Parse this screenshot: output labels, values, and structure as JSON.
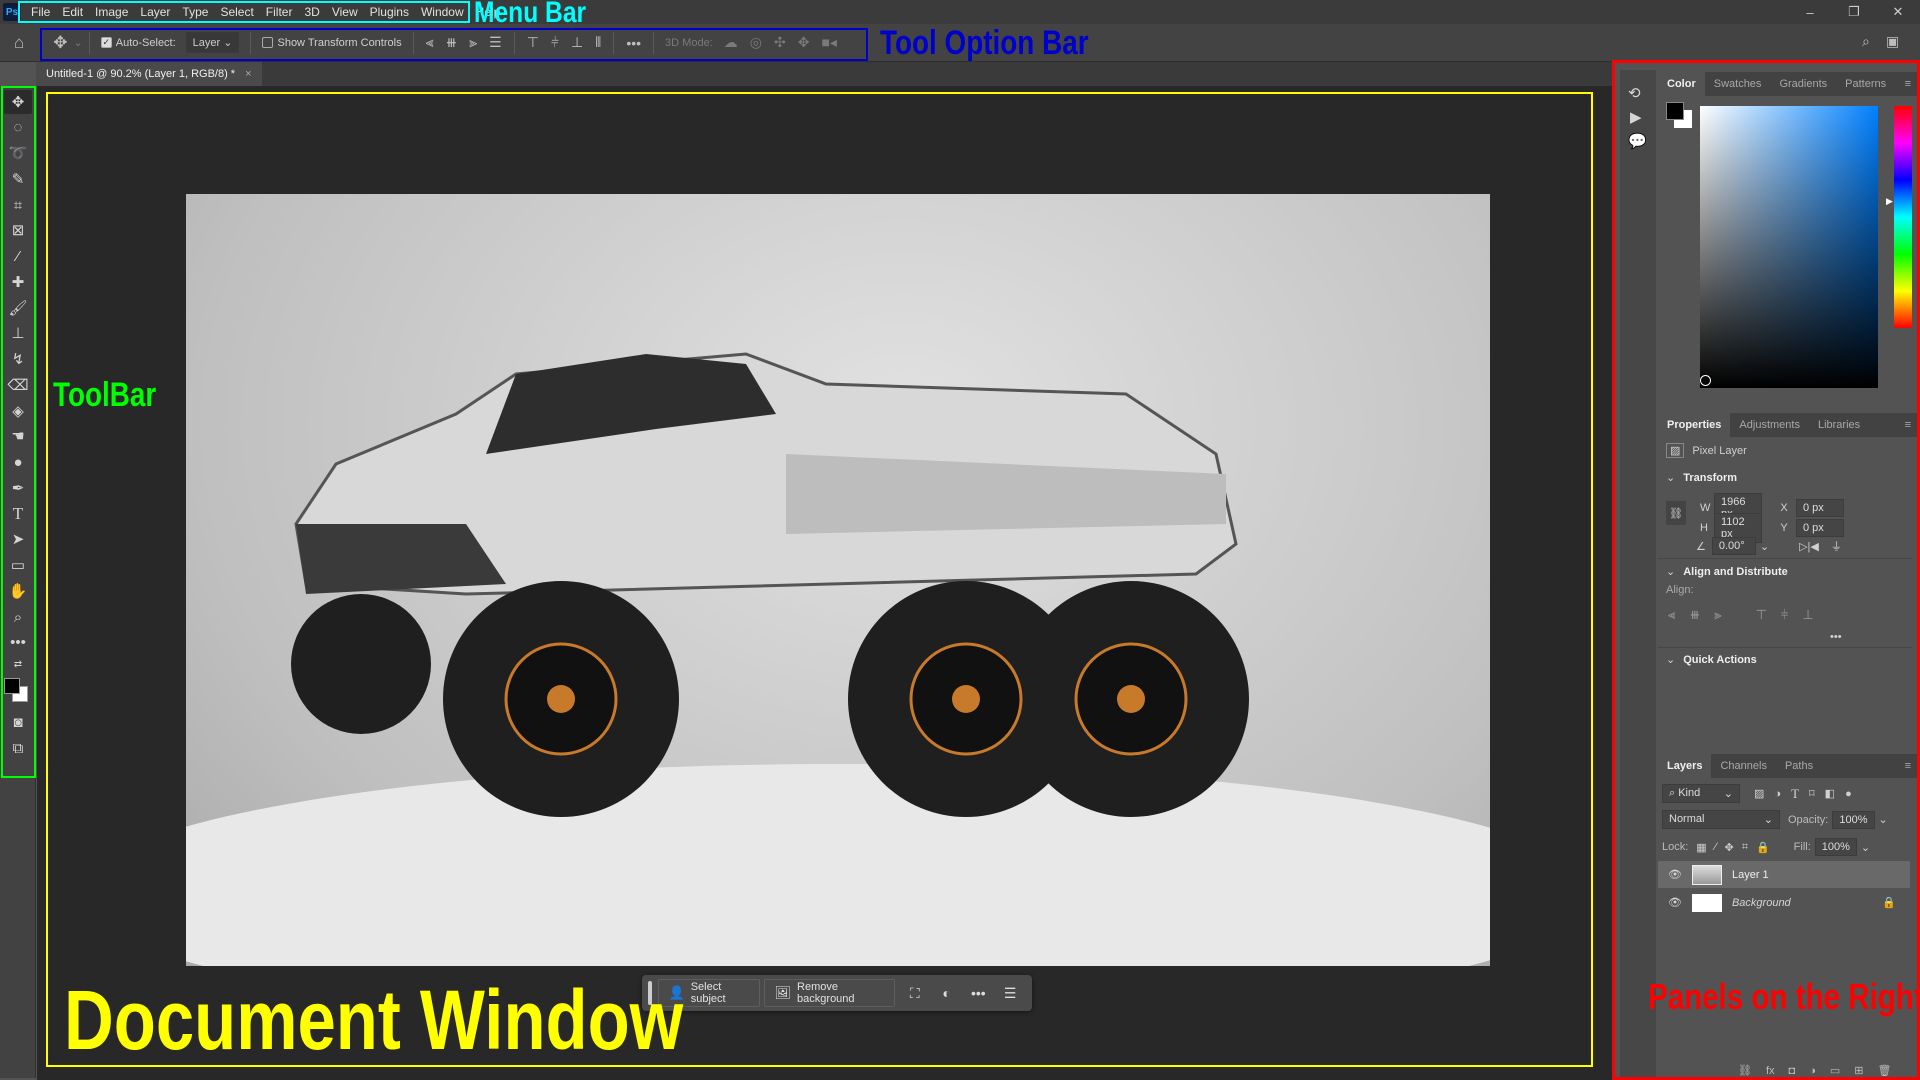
{
  "app": {
    "logo": "Ps"
  },
  "menu": [
    "File",
    "Edit",
    "Image",
    "Layer",
    "Type",
    "Select",
    "Filter",
    "3D",
    "View",
    "Plugins",
    "Window",
    "Help"
  ],
  "window_controls": {
    "minimize": "–",
    "restore": "❐",
    "close": "✕"
  },
  "options": {
    "auto_select_label": "Auto-Select:",
    "auto_select_checked": true,
    "auto_select_target": "Layer",
    "show_transform_label": "Show Transform Controls",
    "show_transform_checked": false,
    "mode_3d_label": "3D Mode:",
    "more": "•••"
  },
  "document": {
    "tab_title": "Untitled-1 @ 90.2% (Layer 1, RGB/8) *",
    "close": "×"
  },
  "contextual_bar": {
    "select_subject": "Select subject",
    "remove_background": "Remove background",
    "more": "•••"
  },
  "color_panel": {
    "tabs": [
      "Color",
      "Swatches",
      "Gradients",
      "Patterns"
    ],
    "active_tab": "Color",
    "foreground": "#000000",
    "background": "#ffffff",
    "hue_color": "#0080ff"
  },
  "properties_panel": {
    "tabs": [
      "Properties",
      "Adjustments",
      "Libraries"
    ],
    "active_tab": "Properties",
    "layer_type": "Pixel Layer",
    "transform": {
      "title": "Transform",
      "w_label": "W",
      "w": "1966 px",
      "h_label": "H",
      "h": "1102 px",
      "x_label": "X",
      "x": "0 px",
      "y_label": "Y",
      "y": "0 px",
      "angle": "0.00°"
    },
    "align": {
      "title": "Align and Distribute",
      "align_label": "Align:",
      "more": "•••"
    },
    "quick_actions": {
      "title": "Quick Actions"
    }
  },
  "layers_panel": {
    "tabs": [
      "Layers",
      "Channels",
      "Paths"
    ],
    "active_tab": "Layers",
    "filter": "Kind",
    "blend_mode": "Normal",
    "opacity_label": "Opacity:",
    "opacity": "100%",
    "lock_label": "Lock:",
    "fill_label": "Fill:",
    "fill": "100%",
    "layers": [
      {
        "name": "Layer 1",
        "visible": true,
        "selected": true
      },
      {
        "name": "Background",
        "visible": true,
        "locked": true
      }
    ]
  },
  "annotations": {
    "menu_bar": "Menu Bar",
    "tool_option_bar": "Tool Option Bar",
    "toolbar": "ToolBar",
    "document_window": "Document Window",
    "panels": "Panels on the Right",
    "colors": {
      "menu_bar": "#00ffff",
      "tool_option_bar": "#0000cc",
      "toolbar": "#00ff00",
      "document_window": "#ffff00",
      "panels": "#ff0000"
    }
  }
}
